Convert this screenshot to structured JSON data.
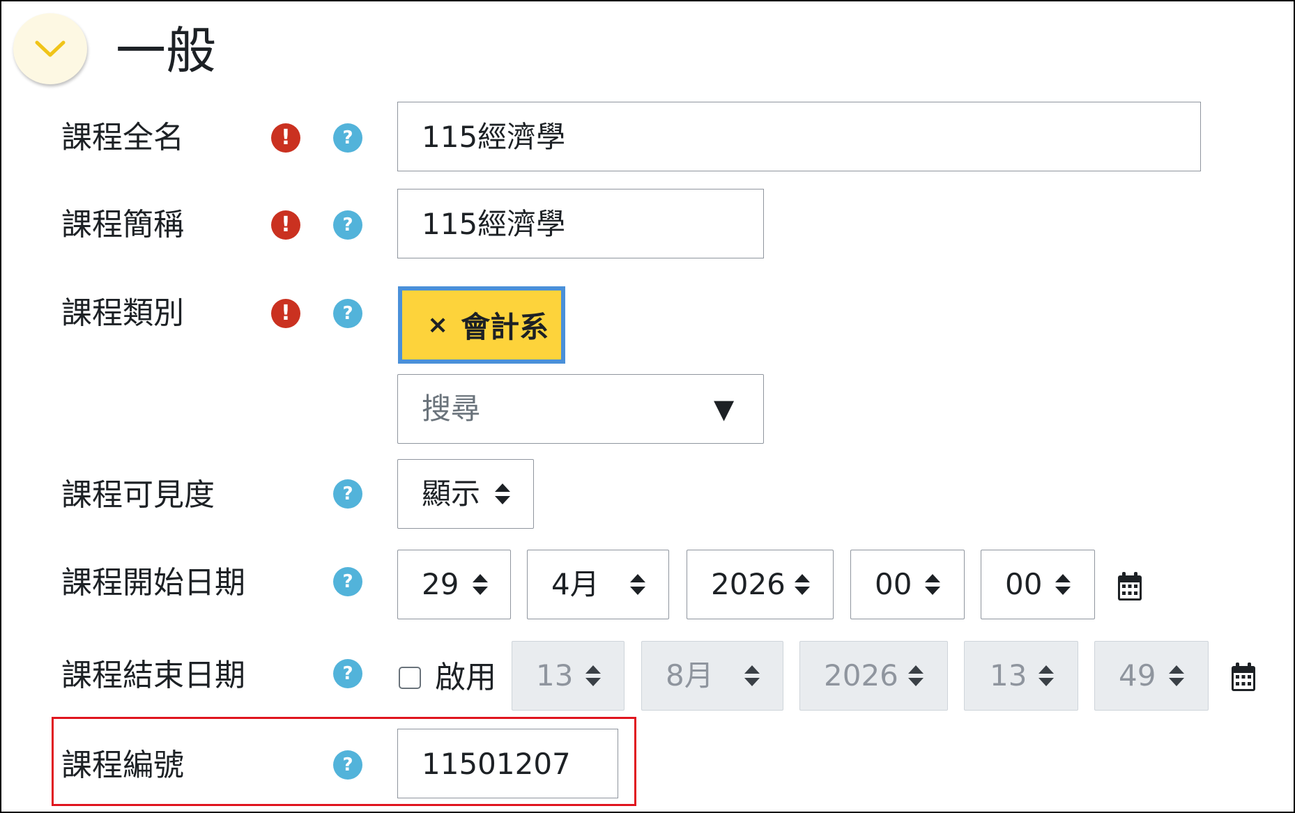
{
  "section": {
    "title": "一般",
    "toggle_icon": "chevron-down-icon"
  },
  "fields": {
    "fullname": {
      "label": "課程全名",
      "value": "115經濟學"
    },
    "shortname": {
      "label": "課程簡稱",
      "value": "115經濟學"
    },
    "category": {
      "label": "課程類別",
      "chip_remove": "×",
      "chip_label": "會計系",
      "search_placeholder": "搜尋",
      "dropdown_arrow": "▼"
    },
    "visibility": {
      "label": "課程可見度",
      "value": "顯示"
    },
    "startdate": {
      "label": "課程開始日期",
      "day": "29",
      "month": "4月",
      "year": "2026",
      "hour": "00",
      "minute": "00"
    },
    "enddate": {
      "label": "課程結束日期",
      "enable_label": "啟用",
      "enabled": false,
      "day": "13",
      "month": "8月",
      "year": "2026",
      "hour": "13",
      "minute": "49"
    },
    "idnumber": {
      "label": "課程編號",
      "value": "11501207"
    }
  },
  "icons": {
    "required": "!",
    "help": "?"
  },
  "colors": {
    "required": "#ca3120",
    "help": "#52b3da",
    "chip": "#fdd33b",
    "chip_border": "#4a90d9",
    "highlight": "#e0141e",
    "header_circle": "#fdf8e3"
  }
}
